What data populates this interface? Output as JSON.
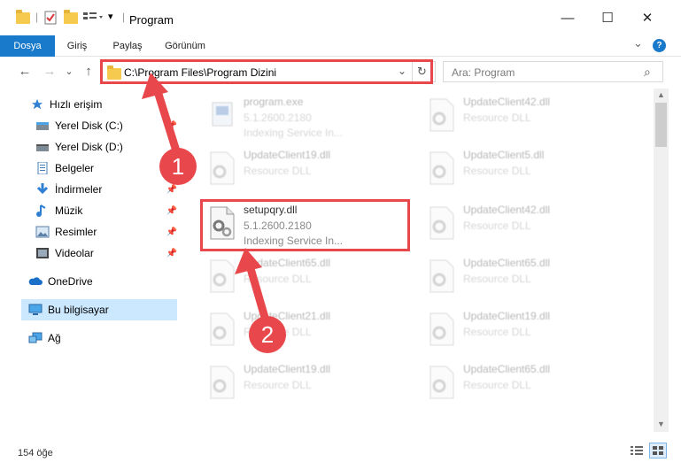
{
  "window": {
    "title": "Program",
    "minimize": "—",
    "maximize": "☐",
    "close": "✕"
  },
  "ribbon": {
    "tabs": [
      "Dosya",
      "Giriş",
      "Paylaş",
      "Görünüm"
    ],
    "help": "?",
    "collapse": "⌄"
  },
  "nav": {
    "back": "←",
    "forward": "→",
    "dropdown": "⌄",
    "up": "↑"
  },
  "address": {
    "path": "C:\\Program Files\\Program Dizini",
    "chevron": "⌄",
    "refresh": "↻"
  },
  "search": {
    "placeholder": "Ara: Program",
    "icon": "⌕"
  },
  "sidebar": {
    "quick_access": "Hızlı erişim",
    "items": [
      {
        "label": "Yerel Disk (C:)",
        "icon": "drive-icon"
      },
      {
        "label": "Yerel Disk (D:)",
        "icon": "drive-icon"
      },
      {
        "label": "Belgeler",
        "icon": "documents-icon"
      },
      {
        "label": "İndirmeler",
        "icon": "downloads-icon"
      },
      {
        "label": "Müzik",
        "icon": "music-icon"
      },
      {
        "label": "Resimler",
        "icon": "pictures-icon"
      },
      {
        "label": "Videolar",
        "icon": "videos-icon"
      }
    ],
    "onedrive": "OneDrive",
    "this_pc": "Bu bilgisayar",
    "network": "Ağ"
  },
  "files": {
    "left": [
      {
        "name": "program.exe",
        "version": "5.1.2600.2180",
        "desc": "Indexing Service In..."
      },
      {
        "name": "UpdateClient19.dll",
        "type": "Resource DLL"
      },
      {
        "name": "setupqry.dll",
        "version": "5.1.2600.2180",
        "desc": "Indexing Service In..."
      },
      {
        "name": "UpdateClient65.dll",
        "type": "Resource DLL"
      },
      {
        "name": "UpdateClient21.dll",
        "type": "Resource DLL"
      },
      {
        "name": "UpdateClient19.dll",
        "type": "Resource DLL"
      }
    ],
    "right": [
      {
        "name": "UpdateClient42.dll",
        "type": "Resource DLL"
      },
      {
        "name": "UpdateClient5.dll",
        "type": "Resource DLL"
      },
      {
        "name": "UpdateClient42.dll",
        "type": "Resource DLL"
      },
      {
        "name": "UpdateClient65.dll",
        "type": "Resource DLL"
      },
      {
        "name": "UpdateClient19.dll",
        "type": "Resource DLL"
      },
      {
        "name": "UpdateClient65.dll",
        "type": "Resource DLL"
      }
    ]
  },
  "status": {
    "count": "154 öğe"
  },
  "annotations": {
    "step1": "1",
    "step2": "2",
    "color": "#e8474b"
  }
}
